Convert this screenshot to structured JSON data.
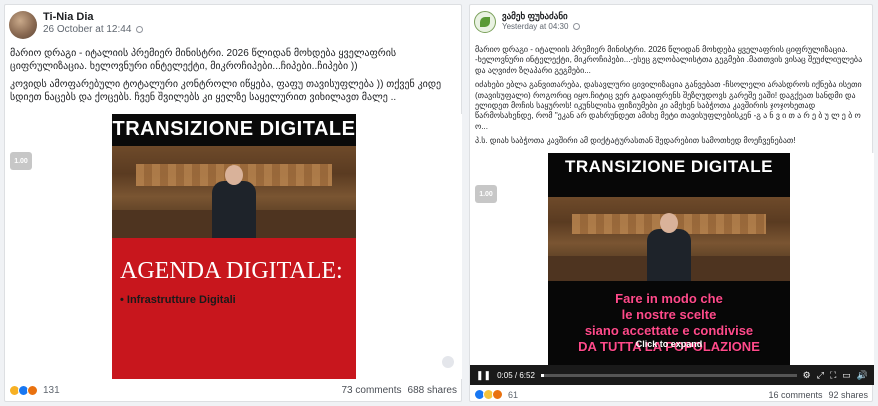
{
  "posts": [
    {
      "author": "Ti-Nia Dia",
      "time": "26 October at 12:44",
      "paragraphs": [
        "მარიო დრაგი - იტალიის პრემიერ მინისტრი. 2026 წლიდან მოხდება ყველაფრის ციფრულიზაცია. ხელოვნური ინტელექტი, მიკროჩიპები...ჩიპები..ჩიპები ))",
        "კოვიდს ამოფარებული ტოტალური კონტროლი იწყება, ფაფუ თავისუფლება )) თქვენ კიდე სდიეთ ნაცებს და ქოცებს. ჩვენ შვილებს კი ყელზე საყელურით ვიხილავთ მალე .."
      ],
      "video": {
        "badge": "1.00",
        "title": "TRANSIZIONE DIGITALE",
        "agenda": "AGENDA DIGITALE:",
        "bullet": "• Infrastrutture Digitali"
      },
      "reaction_count": "131",
      "comments": "73 comments",
      "shares": "688 shares"
    },
    {
      "author": "ვამეხ ფუხაძანი",
      "time": "Yesterday at 04:30",
      "paragraphs": [
        "მარიო დრაგი - იტალიის პრემიერ მინისტრი. 2026 წლიდან მოხდება ყველაფრის ციფრულიზაცია. -ხელოვნური ინტელექტი, მიკროჩიპები...-ესეც გლობალისტთა გეგმები .მათთვის ვისაც შეუძლიულება და აღვიძო ზღაპარი გეგმები...",
        "იძახები ებლა განვითარება, დასავლური ცივილიზაცია განვებათ -ჩსოლელი არასდროს იქნება ისეთი (თავისუფალი) როგორიც იყო.ჩიტიც ვერ გადაიფრენს შეზღუდოვს გარეშე ეაში! დაგქეათ სანდმი და ელიდეთ მოჩის საყუროს! იკუნსლისა ფიზიუმები კი ამეხენ საბჭოთა კავშირის ჯოჯოხეთად წარმოსახენდე, რომ \"ეკან არ დახრუნდეთ ამიხე მეტი თავისუფლებისკენ -გ ა ნ ვ ი თ ა რ ე ბ უ ლ ე ბ ო ო...",
        "პ.ს. დიახ საბჭოთა კავშირი ამ დიქტატურასთან შედარებით სამოთხედ მოეჩვენებათ!"
      ],
      "video": {
        "badge": "1.00",
        "title": "TRANSIZIONE DIGITALE",
        "subtitle": [
          "Fare in modo che",
          "le nostre scelte",
          "siano accettate e condivise",
          "DA TUTTA LA POPOLAZIONE"
        ],
        "click_to_expand": "Click to expand",
        "time": "0:05 / 6:52",
        "progress": 0.013
      },
      "reaction_count": "61",
      "comments": "16 comments",
      "shares": "92 shares"
    }
  ],
  "colors": {
    "fb_blue": "#1877f2",
    "red_banner": "#c8161d",
    "subtitle_pink": "#ff4a8a"
  }
}
